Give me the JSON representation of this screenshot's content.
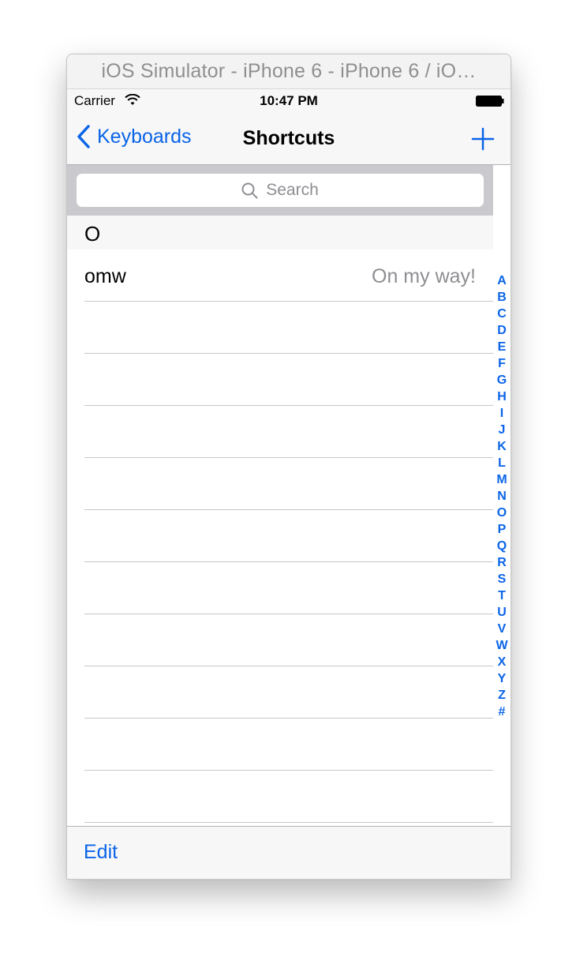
{
  "window": {
    "title": "iOS Simulator - iPhone 6 - iPhone 6 / iO…"
  },
  "status_bar": {
    "carrier": "Carrier",
    "time": "10:47 PM"
  },
  "nav": {
    "back_label": "Keyboards",
    "title": "Shortcuts",
    "add_icon": "plus-icon",
    "back_icon": "chevron-left-icon"
  },
  "search": {
    "placeholder": "Search",
    "icon": "magnifier-icon"
  },
  "section": {
    "header": "O"
  },
  "rows": [
    {
      "phrase": "omw",
      "expansion": "On my way!"
    },
    {
      "phrase": "",
      "expansion": ""
    },
    {
      "phrase": "",
      "expansion": ""
    },
    {
      "phrase": "",
      "expansion": ""
    },
    {
      "phrase": "",
      "expansion": ""
    },
    {
      "phrase": "",
      "expansion": ""
    },
    {
      "phrase": "",
      "expansion": ""
    },
    {
      "phrase": "",
      "expansion": ""
    },
    {
      "phrase": "",
      "expansion": ""
    },
    {
      "phrase": "",
      "expansion": ""
    },
    {
      "phrase": "",
      "expansion": ""
    }
  ],
  "index": [
    "A",
    "B",
    "C",
    "D",
    "E",
    "F",
    "G",
    "H",
    "I",
    "J",
    "K",
    "L",
    "M",
    "N",
    "O",
    "P",
    "Q",
    "R",
    "S",
    "T",
    "U",
    "V",
    "W",
    "X",
    "Y",
    "Z",
    "#"
  ],
  "toolbar": {
    "edit_label": "Edit"
  },
  "colors": {
    "tint": "#0a64e8",
    "secondary_text": "#8e8e93"
  }
}
